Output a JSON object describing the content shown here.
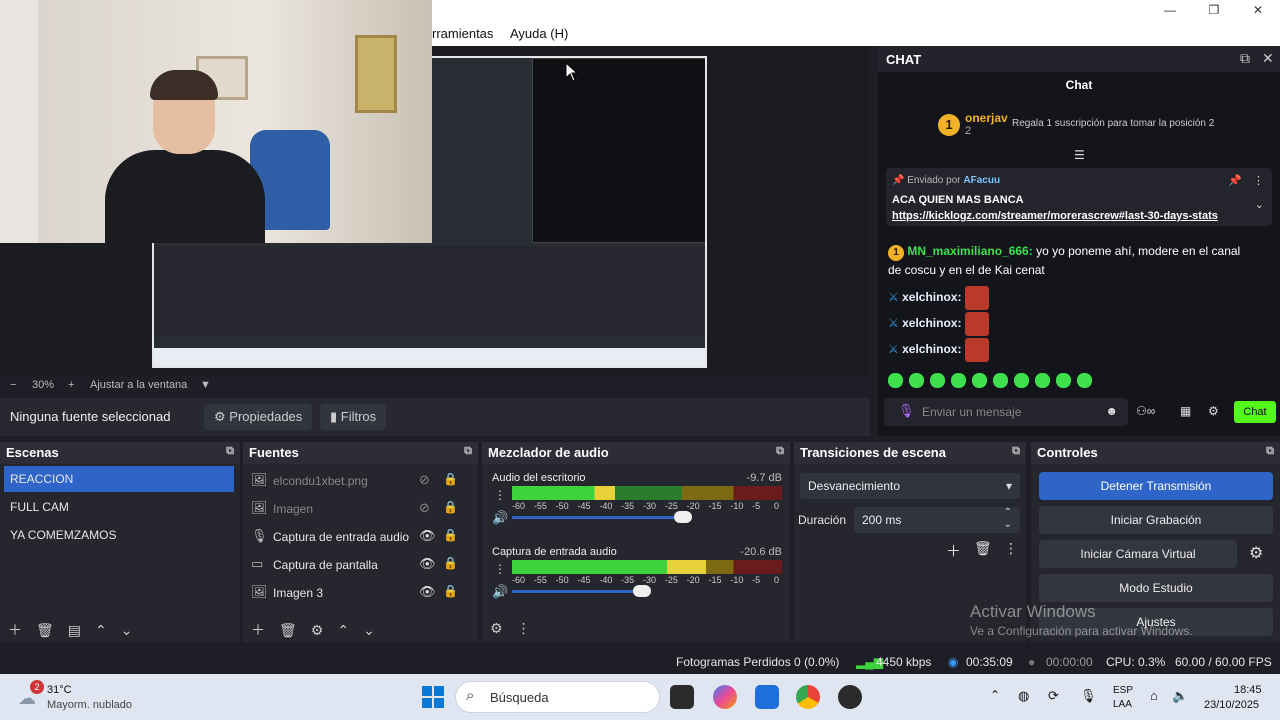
{
  "window": {
    "minimize": "—",
    "maximize": "❐",
    "close": "✕"
  },
  "menu": {
    "items": [
      "rramientas",
      "Ayuda (H)"
    ]
  },
  "zoom": {
    "minus": "−",
    "value": "30%",
    "plus": "+",
    "fit": "Ajustar a la ventana",
    "caret": "▼"
  },
  "source_toolbar": {
    "none_selected": "Ninguna fuente seleccionad",
    "properties": "Propiedades",
    "filters": "Filtros"
  },
  "chat": {
    "dock_title": "CHAT",
    "title": "Chat",
    "top_gifter": {
      "rank": "1",
      "name": "onerjav",
      "count": "2",
      "gift_text": "Regala 1 suscripción para tomar la posición 2"
    },
    "pinned": {
      "sent_by": "Enviado por",
      "user": "AFacuu",
      "message": "ACA QUIEN MAS BANCA",
      "link": "https://kicklogz.com/streamer/morerascrew#last-30-days-stats"
    },
    "messages": [
      {
        "badge": "1",
        "user": "MN_maximiliano_666:",
        "text": "yo yo poneme ahí, modere en el canal",
        "text2": "de coscu y en el de Kai cenat"
      },
      {
        "user": "xelchinox:"
      },
      {
        "user": "xelchinox:"
      },
      {
        "user": "xelchinox:"
      }
    ],
    "input_placeholder": "Enviar un mensaje",
    "send_button": "Chat"
  },
  "scenes": {
    "title": "Escenas",
    "items": [
      {
        "label": "REACCION",
        "selected": true
      },
      {
        "label": "FULL CAM",
        "selected": false
      },
      {
        "label": "YA COMEMZAMOS",
        "selected": false
      }
    ]
  },
  "sources": {
    "title": "Fuentes",
    "items": [
      {
        "label": "elcondu1xbet.png",
        "icon": "image-icon",
        "visible": false
      },
      {
        "label": "Imagen",
        "icon": "image-icon",
        "visible": false
      },
      {
        "label": "Captura de entrada audio",
        "icon": "microphone-icon",
        "visible": true
      },
      {
        "label": "Captura de pantalla",
        "icon": "monitor-icon",
        "visible": true
      },
      {
        "label": "Imagen 3",
        "icon": "image-icon",
        "visible": true
      }
    ]
  },
  "mixer": {
    "title": "Mezclador de audio",
    "scale": [
      "-60",
      "-55",
      "-50",
      "-45",
      "-40",
      "-35",
      "-30",
      "-25",
      "-20",
      "-15",
      "-10",
      "-5",
      "0"
    ],
    "channels": [
      {
        "name": "Audio del escritorio",
        "db": "-9.7 dB",
        "level": 0.38,
        "volume": 0.95
      },
      {
        "name": "Captura de entrada audio",
        "db": "-20.6 dB",
        "level": 0.72,
        "volume": 0.72
      }
    ]
  },
  "transitions": {
    "title": "Transiciones de escena",
    "selected": "Desvanecimiento",
    "duration_label": "Duración",
    "duration_value": "200 ms"
  },
  "controls": {
    "title": "Controles",
    "buttons": [
      "Detener Transmisión",
      "Iniciar Grabación",
      "Iniciar Cámara Virtual",
      "Modo Estudio",
      "Ajustes"
    ]
  },
  "watermark": {
    "line1": "Activar Windows",
    "line2": "Ve a Configuración para activar Windows."
  },
  "status": {
    "dropped": "Fotogramas Perdidos 0 (0.0%)",
    "bitrate": "4450 kbps",
    "stream_time": "00:35:09",
    "record_time": "00:00:00",
    "cpu": "CPU: 0.3%",
    "fps": "60.00 / 60.00 FPS"
  },
  "taskbar": {
    "weather_badge": "2",
    "temp": "31°C",
    "weather": "Mayorm. nublado",
    "search": "Búsqueda",
    "lang1": "ESP",
    "lang2": "LAA",
    "time": "18:45",
    "date": "23/10/2025"
  },
  "colors": {
    "accent": "#2f64c8",
    "kick_green": "#53fc18",
    "gold": "#f1b227"
  }
}
